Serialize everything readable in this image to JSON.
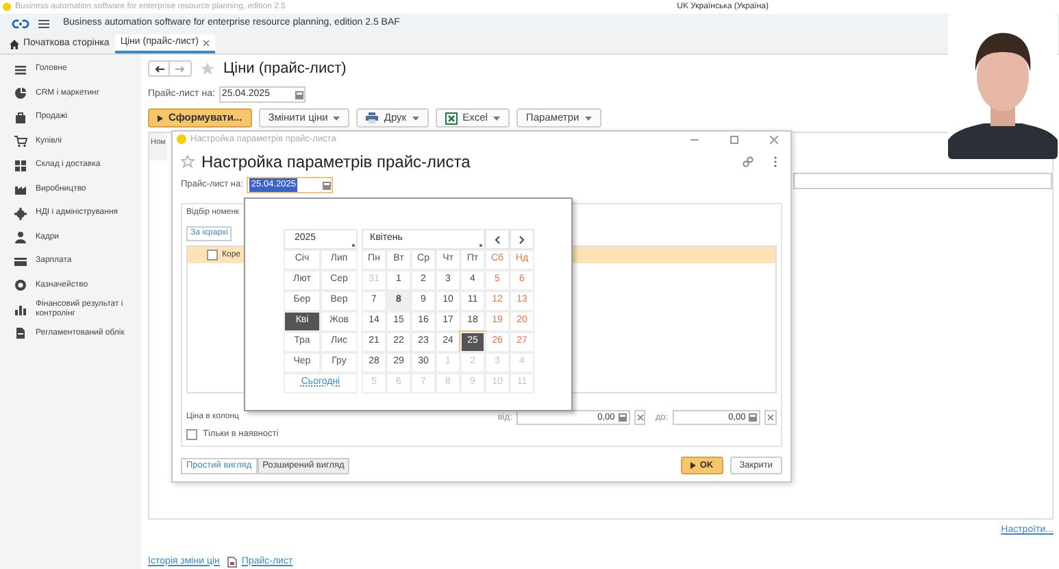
{
  "os_window": {
    "title": "Business automation software for enterprise resource planning, edition 2.5",
    "language": "UK Українська (Україна)"
  },
  "app_bar": {
    "title": "Business automation software for enterprise resource planning, edition 2.5 BAF"
  },
  "tabs": [
    {
      "label": "Початкова сторінка",
      "selected": false,
      "kind": "home"
    },
    {
      "label": "Ціни (прайс-лист)",
      "selected": true,
      "kind": "doc"
    }
  ],
  "sidebar": {
    "items": [
      {
        "label": "Головне"
      },
      {
        "label": "CRM і маркетинг"
      },
      {
        "label": "Продажі"
      },
      {
        "label": "Купівлі"
      },
      {
        "label": "Склад і доставка"
      },
      {
        "label": "Виробництво"
      },
      {
        "label": "НДІ і адміністрування"
      },
      {
        "label": "Кадри"
      },
      {
        "label": "Зарплата"
      },
      {
        "label": "Казначейство"
      },
      {
        "label": "Фінансовий результат і контролінг"
      },
      {
        "label": "Регламентований облік"
      }
    ]
  },
  "form": {
    "title": "Ціни (прайс-лист)",
    "date_label": "Прайс-лист на:",
    "date_value": "25.04.2025",
    "toolbar": [
      {
        "label": "Сформувати...",
        "kind": "primary"
      },
      {
        "label": "Змінити ціни",
        "kind": "dropdown"
      },
      {
        "label": "Друк",
        "kind": "print"
      },
      {
        "label": "Excel",
        "kind": "excel"
      },
      {
        "label": "Параметри",
        "kind": "dropdown"
      }
    ],
    "table_header": "Ном",
    "settings_link": "Настроїти...",
    "bottom_links": [
      {
        "label": "Історія зміни цін",
        "kind": "plain"
      },
      {
        "label": "Прайс-лист",
        "kind": "report"
      }
    ]
  },
  "dialog": {
    "window_title": "Настройка параметрів прайс-листа",
    "title": "Настройка параметрів прайс-листа",
    "date_label": "Прайс-лист на:",
    "date_value": "25.04.2025",
    "group_title": "Відбір номенк",
    "hierarchy_link": "За ієрархі",
    "column_header": "Коре",
    "column_checked": false,
    "price_label": "Ціна в колонц",
    "from_label": "від:",
    "from_value": "0,00",
    "to_label": "до:",
    "to_value": "0,00",
    "in_stock": {
      "label": "Тільки в наявності",
      "checked": false
    },
    "views": [
      {
        "label": "Простий вигляд",
        "selected": true
      },
      {
        "label": "Розширений вигляд",
        "selected": false
      }
    ],
    "ok": "OK",
    "close": "Закрити"
  },
  "calendar": {
    "year": "2025",
    "month": "Квітень",
    "months": [
      {
        "label": "Січ",
        "selected": false
      },
      {
        "label": "Лип",
        "selected": false
      },
      {
        "label": "Лют",
        "selected": false
      },
      {
        "label": "Сер",
        "selected": false
      },
      {
        "label": "Бер",
        "selected": false
      },
      {
        "label": "Вер",
        "selected": false
      },
      {
        "label": "Кві",
        "selected": true
      },
      {
        "label": "Жов",
        "selected": false
      },
      {
        "label": "Тра",
        "selected": false
      },
      {
        "label": "Лис",
        "selected": false
      },
      {
        "label": "Чер",
        "selected": false
      },
      {
        "label": "Гру",
        "selected": false
      }
    ],
    "today_link": "Сьогодні",
    "weekdays": [
      {
        "label": "Пн",
        "weekend": false
      },
      {
        "label": "Вт",
        "weekend": false
      },
      {
        "label": "Ср",
        "weekend": false
      },
      {
        "label": "Чт",
        "weekend": false
      },
      {
        "label": "Пт",
        "weekend": false
      },
      {
        "label": "Сб",
        "weekend": true
      },
      {
        "label": "Нд",
        "weekend": true
      }
    ],
    "days": [
      {
        "text": "31",
        "kind": "outside",
        "selected": false,
        "today": false
      },
      {
        "text": "1",
        "kind": "day",
        "selected": false,
        "today": false
      },
      {
        "text": "2",
        "kind": "day",
        "selected": false,
        "today": false
      },
      {
        "text": "3",
        "kind": "day",
        "selected": false,
        "today": false
      },
      {
        "text": "4",
        "kind": "day",
        "selected": false,
        "today": false
      },
      {
        "text": "5",
        "kind": "weekend",
        "selected": false,
        "today": false
      },
      {
        "text": "6",
        "kind": "weekend",
        "selected": false,
        "today": false
      },
      {
        "text": "7",
        "kind": "day",
        "selected": false,
        "today": false
      },
      {
        "text": "8",
        "kind": "day",
        "selected": false,
        "today": true
      },
      {
        "text": "9",
        "kind": "day",
        "selected": false,
        "today": false
      },
      {
        "text": "10",
        "kind": "day",
        "selected": false,
        "today": false
      },
      {
        "text": "11",
        "kind": "day",
        "selected": false,
        "today": false
      },
      {
        "text": "12",
        "kind": "weekend",
        "selected": false,
        "today": false
      },
      {
        "text": "13",
        "kind": "weekend",
        "selected": false,
        "today": false
      },
      {
        "text": "14",
        "kind": "day",
        "selected": false,
        "today": false
      },
      {
        "text": "15",
        "kind": "day",
        "selected": false,
        "today": false
      },
      {
        "text": "16",
        "kind": "day",
        "selected": false,
        "today": false
      },
      {
        "text": "17",
        "kind": "day",
        "selected": false,
        "today": false
      },
      {
        "text": "18",
        "kind": "day",
        "selected": false,
        "today": false
      },
      {
        "text": "19",
        "kind": "weekend",
        "selected": false,
        "today": false
      },
      {
        "text": "20",
        "kind": "weekend",
        "selected": false,
        "today": false
      },
      {
        "text": "21",
        "kind": "day",
        "selected": false,
        "today": false
      },
      {
        "text": "22",
        "kind": "day",
        "selected": false,
        "today": false
      },
      {
        "text": "23",
        "kind": "day",
        "selected": false,
        "today": false
      },
      {
        "text": "24",
        "kind": "day",
        "selected": false,
        "today": false
      },
      {
        "text": "25",
        "kind": "day",
        "selected": true,
        "today": false
      },
      {
        "text": "26",
        "kind": "weekend",
        "selected": false,
        "today": false
      },
      {
        "text": "27",
        "kind": "weekend",
        "selected": false,
        "today": false
      },
      {
        "text": "28",
        "kind": "day",
        "selected": false,
        "today": false
      },
      {
        "text": "29",
        "kind": "day",
        "selected": false,
        "today": false
      },
      {
        "text": "30",
        "kind": "day",
        "selected": false,
        "today": false
      },
      {
        "text": "1",
        "kind": "outside",
        "selected": false,
        "today": false
      },
      {
        "text": "2",
        "kind": "outside",
        "selected": false,
        "today": false
      },
      {
        "text": "3",
        "kind": "outside",
        "selected": false,
        "today": false
      },
      {
        "text": "4",
        "kind": "outside",
        "selected": false,
        "today": false
      },
      {
        "text": "5",
        "kind": "outside",
        "selected": false,
        "today": false
      },
      {
        "text": "6",
        "kind": "outside",
        "selected": false,
        "today": false
      },
      {
        "text": "7",
        "kind": "outside",
        "selected": false,
        "today": false
      },
      {
        "text": "8",
        "kind": "outside",
        "selected": false,
        "today": false
      },
      {
        "text": "9",
        "kind": "outside",
        "selected": false,
        "today": false
      },
      {
        "text": "10",
        "kind": "outside",
        "selected": false,
        "today": false
      },
      {
        "text": "11",
        "kind": "outside",
        "selected": false,
        "today": false
      }
    ]
  }
}
